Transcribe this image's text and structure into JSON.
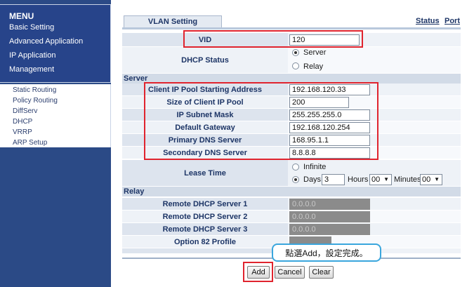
{
  "sidebar": {
    "title": "MENU",
    "items": [
      "Basic Setting",
      "Advanced Application",
      "IP Application",
      "Management"
    ],
    "sub_items": [
      "Static Routing",
      "Policy Routing",
      "DiffServ",
      "DHCP",
      "VRRP",
      "ARP Setup"
    ]
  },
  "tabs": {
    "active": "VLAN Setting",
    "links": [
      "Status",
      "Port"
    ]
  },
  "form": {
    "vid": {
      "label": "VID",
      "value": "120"
    },
    "dhcp_status": {
      "label": "DHCP Status",
      "options": [
        "Server",
        "Relay"
      ],
      "selected": "Server"
    },
    "server_section": "Server",
    "pool_start": {
      "label": "Client IP Pool Starting Address",
      "value": "192.168.120.33"
    },
    "pool_size": {
      "label": "Size of Client IP Pool",
      "value": "200"
    },
    "subnet_mask": {
      "label": "IP Subnet Mask",
      "value": "255.255.255.0"
    },
    "gateway": {
      "label": "Default Gateway",
      "value": "192.168.120.254"
    },
    "dns1": {
      "label": "Primary DNS Server",
      "value": "168.95.1.1"
    },
    "dns2": {
      "label": "Secondary DNS Server",
      "value": "8.8.8.8"
    },
    "lease": {
      "label": "Lease Time",
      "infinite_label": "Infinite",
      "days_label": "Days",
      "days_value": "3",
      "hours_label": "Hours",
      "hours_value": "00",
      "minutes_label": "Minutes",
      "minutes_value": "00",
      "selected": "Days"
    },
    "relay_section": "Relay",
    "relay1": {
      "label": "Remote DHCP Server 1",
      "value": "0.0.0.0"
    },
    "relay2": {
      "label": "Remote DHCP Server 2",
      "value": "0.0.0.0"
    },
    "relay3": {
      "label": "Remote DHCP Server 3",
      "value": "0.0.0.0"
    },
    "option82": {
      "label": "Option 82 Profile"
    }
  },
  "buttons": {
    "add": "Add",
    "cancel": "Cancel",
    "clear": "Clear"
  },
  "callout": "點選Add，設定完成。",
  "colors": {
    "sidebar": "#2b4a86",
    "highlight": "#e0242e",
    "callout_border": "#3aa6dd"
  }
}
